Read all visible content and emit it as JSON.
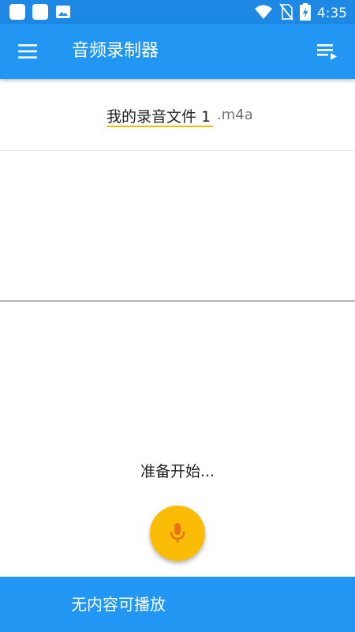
{
  "status_bar": {
    "time": "4:35",
    "left_icons": [
      "app-notification-icon",
      "app-notification-icon",
      "image-icon"
    ],
    "right_icons": [
      "wifi-icon",
      "no-sim-icon",
      "battery-charging-icon"
    ]
  },
  "app_bar": {
    "title": "音频录制器",
    "menu_icon": "hamburger-menu-icon",
    "playlist_icon": "playlist-play-icon"
  },
  "filename": {
    "value": "我的录音文件 1",
    "extension": ".m4a"
  },
  "recorder": {
    "status_text": "准备开始...",
    "record_icon": "microphone-icon"
  },
  "bottom_bar": {
    "label": "无内容可播放"
  },
  "colors": {
    "status_bar": "#1e88e5",
    "app_bar": "#2196f3",
    "accent": "#fbbc05",
    "mic": "#e8711a"
  }
}
